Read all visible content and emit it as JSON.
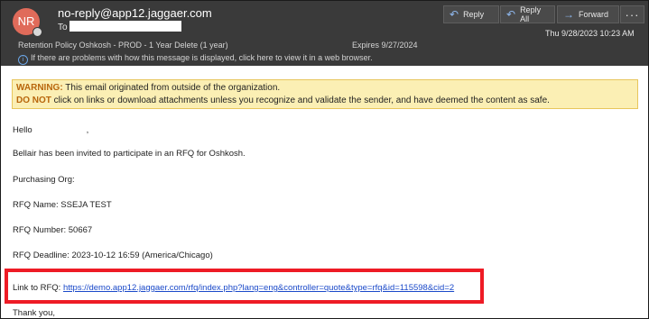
{
  "header": {
    "avatar_initials": "NR",
    "sender": "no-reply@app12.jaggaer.com",
    "to_label": "To",
    "retention": "Retention Policy  Oshkosh - PROD - 1 Year Delete (1 year)",
    "expires": "Expires  9/27/2024",
    "info_message": "If there are problems with how this message is displayed, click here to view it in a web browser.",
    "date": "Thu 9/28/2023 10:23 AM",
    "buttons": {
      "reply": "Reply",
      "reply_all": "Reply All",
      "forward": "Forward",
      "more": "···"
    }
  },
  "warning": {
    "label": "WARNING:",
    "line1": " This email originated from outside of the organization.",
    "donot": "DO NOT",
    "line2": " click on links or download attachments unless you recognize and validate the sender, and have deemed the content as safe."
  },
  "body": {
    "greeting": "Hello",
    "greeting_end": ",",
    "invite": "Bellair has been invited to participate in an RFQ for Oshkosh.",
    "purchasing_org": "Purchasing Org:",
    "rfq_name": "RFQ Name: SSEJA TEST",
    "rfq_number": "RFQ Number: 50667",
    "rfq_deadline": "RFQ Deadline: 2023-10-12 16:59 (America/Chicago)",
    "link_label": "Link to RFQ: ",
    "link_url": "https://demo.app12.jaggaer.com/rfq/index.php?lang=eng&controller=quote&type=rfq&id=115598&cid=2",
    "thanks": "Thank you,"
  },
  "colors": {
    "header_bg": "#3a3a3a",
    "avatar": "#e06b5a",
    "warning_bg": "#fbefb4",
    "warning_text": "#b8660c",
    "link": "#1a49c9",
    "highlight": "#ee1b25"
  },
  "icons": {
    "reply": "reply-arrow-icon",
    "reply_all": "reply-all-arrow-icon",
    "forward": "forward-arrow-icon",
    "info": "info-icon"
  }
}
